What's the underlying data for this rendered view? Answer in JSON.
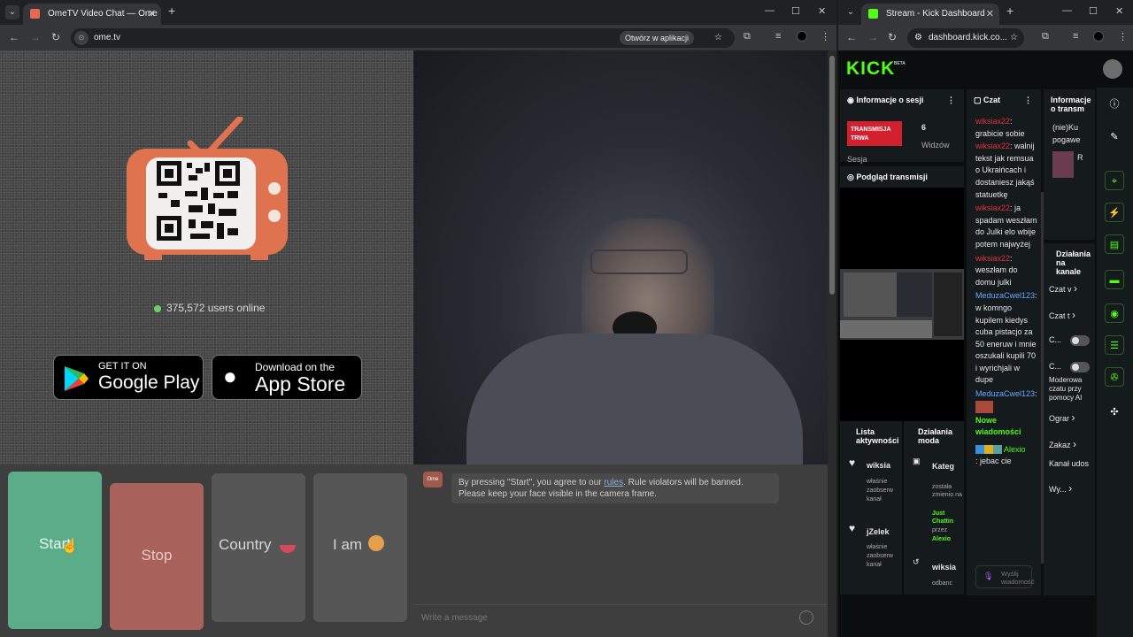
{
  "left_window": {
    "tab_title": "OmeTV Video Chat — Ome",
    "new_tab": "+",
    "url": "ome.tv",
    "open_in_app": "Otwórz w aplikacji",
    "controls": {
      "minimize": "—",
      "maximize": "☐",
      "close": "✕"
    }
  },
  "ometv": {
    "users_online": "375,572 users online",
    "google_play": {
      "small": "GET IT ON",
      "big": "Google Play"
    },
    "app_store": {
      "small": "Download on the",
      "big": "App Store"
    },
    "buttons": {
      "start": "Start",
      "stop": "Stop",
      "country": "Country",
      "iam": "I am"
    },
    "notice_line1_pre": "By pressing \"Start\", you agree to our ",
    "notice_link": "rules",
    "notice_line1_post": ". Rule violators will be banned.",
    "notice_line2": "Please keep your face visible in the camera frame.",
    "message_placeholder": "Write a message"
  },
  "right_window": {
    "tab_title": "Stream - Kick Dashboard",
    "new_tab": "+",
    "url": "dashboard.kick.co...",
    "controls": {
      "minimize": "—",
      "maximize": "☐",
      "close": "✕"
    }
  },
  "kick": {
    "logo": "KICK",
    "beta": "BETA",
    "session_panel": {
      "title": "Informacje o sesji",
      "live_badge": "TRANSMISJA TRWA",
      "viewers_count": "6",
      "viewers_label": "Widzów",
      "session_label": "Sesja"
    },
    "preview_panel": {
      "title": "Podgląd transmisji"
    },
    "chat_panel": {
      "title": "Czat",
      "placeholder": "Wyślij wiadomość",
      "new_messages": "Nowe wiadomości"
    },
    "chat_messages": [
      {
        "user": "wiksiax22",
        "text": ": grabicie sobie"
      },
      {
        "user": "wiksiax22",
        "text": ": walnij tekst jak remsua o Ukraińcach i dostaniesz jakąś statuetkę"
      },
      {
        "user": "wiksiax22",
        "text": ": ja spadam weszłam do Julki elo wbije potem najwyżej"
      },
      {
        "user": "wiksiax22",
        "text": ": weszłam do domu julki"
      },
      {
        "user": "MeduzaCwel123",
        "text": ": w komngo kupilem kiedys cuba pistacjo za 50 eneruw i mnie oszukali kupili 70 i wyrichjali w dupe"
      },
      {
        "user": "MeduzaCwel123",
        "text": ":"
      },
      {
        "user": "Alexio",
        "text": ": jebac cie"
      }
    ],
    "info_panel": {
      "title": "Informacje o transm",
      "line1": "(nie)Ku",
      "line2": "pogawe",
      "initial": "R"
    },
    "actions_panel": {
      "title": "Działania na kanale",
      "items": [
        "Czat v",
        "Czat t",
        "C...",
        "C...",
        "Moderowa czatu przy pomocy AI",
        "Ograr",
        "Zakaz",
        "Kanał udos",
        "Wy..."
      ]
    },
    "activity_panel": {
      "title": "Lista aktywności",
      "entries": [
        {
          "name": "wiksia",
          "desc": "właśnie zaobserw kanał"
        },
        {
          "name": "jZelek",
          "desc": "właśnie zaobserw kanał"
        }
      ]
    },
    "mod_panel": {
      "title": "Działania moda",
      "entries": [
        {
          "name": "Kateg",
          "desc": "została zmienio na",
          "highlight": "Just Chattin",
          "by": "przez",
          "who": "Alexio"
        },
        {
          "name": "wiksia",
          "desc": "odbanc"
        }
      ]
    }
  }
}
